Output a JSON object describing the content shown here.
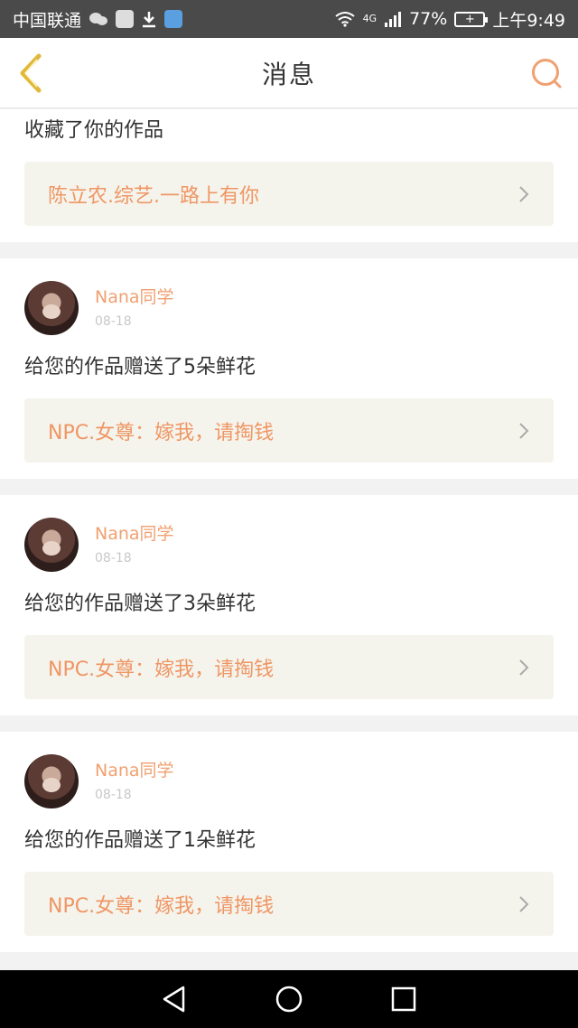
{
  "status_bar": {
    "carrier": "中国联通",
    "network": "4G",
    "battery": "77%",
    "time": "上午9:49"
  },
  "header": {
    "title": "消息"
  },
  "messages": [
    {
      "action": "收藏了你的作品",
      "work": "陈立农.综艺.一路上有你"
    },
    {
      "user": "Nana同学",
      "date": "08-18",
      "action": "给您的作品赠送了5朵鲜花",
      "work": "NPC.女尊：嫁我，请掏钱"
    },
    {
      "user": "Nana同学",
      "date": "08-18",
      "action": "给您的作品赠送了3朵鲜花",
      "work": "NPC.女尊：嫁我，请掏钱"
    },
    {
      "user": "Nana同学",
      "date": "08-18",
      "action": "给您的作品赠送了1朵鲜花",
      "work": "NPC.女尊：嫁我，请掏钱"
    }
  ],
  "colors": {
    "accent": "#ef9665",
    "back_icon": "#e0b93a",
    "card_link_bg": "#f5f4ec"
  }
}
